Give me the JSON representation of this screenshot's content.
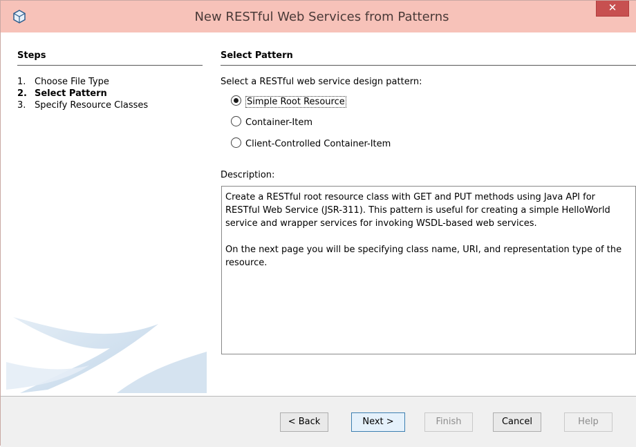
{
  "window": {
    "title": "New RESTful Web Services from Patterns",
    "close_label": "✕"
  },
  "steps": {
    "heading": "Steps",
    "items": [
      {
        "num": "1.",
        "label": "Choose File Type"
      },
      {
        "num": "2.",
        "label": "Select Pattern"
      },
      {
        "num": "3.",
        "label": "Specify Resource Classes"
      }
    ],
    "current_index": 1
  },
  "content": {
    "heading": "Select Pattern",
    "prompt": "Select a RESTful web service design pattern:",
    "patterns": [
      {
        "label": "Simple Root Resource",
        "selected": true
      },
      {
        "label": "Container-Item",
        "selected": false
      },
      {
        "label": "Client-Controlled Container-Item",
        "selected": false
      }
    ],
    "description_label": "Description:",
    "description_paragraphs": [
      "Create a RESTful root resource class with GET and PUT methods using Java API for RESTful Web Service (JSR-311). This pattern is useful for creating a simple HelloWorld service and wrapper services for invoking WSDL-based web services.",
      "On the next page you will be specifying class name, URI, and representation type of the resource."
    ]
  },
  "buttons": {
    "back": "< Back",
    "next": "Next >",
    "finish": "Finish",
    "cancel": "Cancel",
    "help": "Help"
  },
  "colors": {
    "titlebar": "#f7c2b9",
    "close": "#c75050",
    "button_bar": "#f0f0f0"
  }
}
